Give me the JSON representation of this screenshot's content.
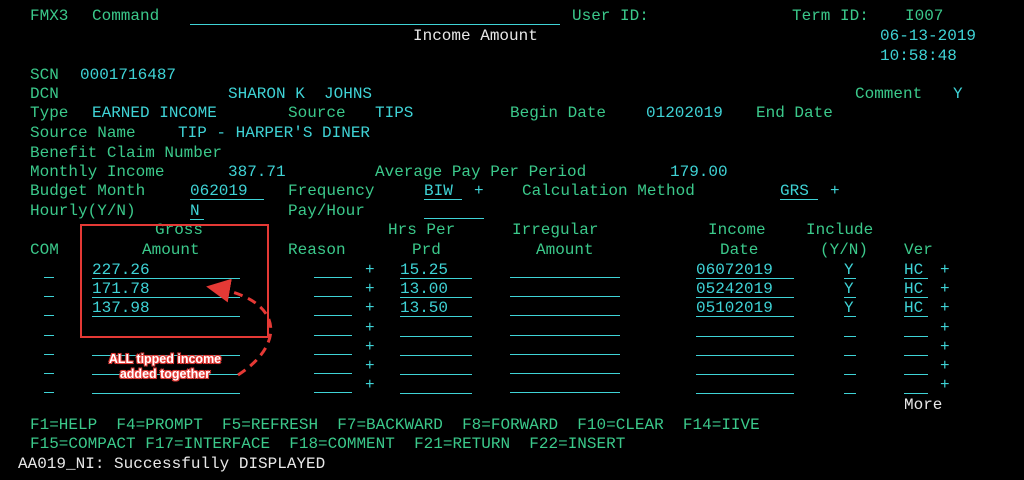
{
  "header": {
    "screen_id": "FMX3",
    "command_label": "Command",
    "user_id_label": "User ID:",
    "term_id_label": "Term ID:",
    "term_id": "I007",
    "title": "Income Amount",
    "date": "06-13-2019",
    "time": "10:58:48"
  },
  "case": {
    "scn_label": "SCN",
    "scn": "0001716487",
    "dcn_label": "DCN",
    "name": "SHARON K  JOHNS",
    "comment_label": "Comment",
    "comment": "Y",
    "type_label": "Type",
    "type": "EARNED INCOME",
    "source_label": "Source",
    "source": "TIPS",
    "begin_date_label": "Begin Date",
    "begin_date": "01202019",
    "end_date_label": "End Date",
    "source_name_label": "Source Name",
    "source_name": "TIP - HARPER'S DINER",
    "benefit_claim_label": "Benefit Claim Number",
    "monthly_income_label": "Monthly Income",
    "monthly_income": "387.71",
    "avg_pay_label": "Average Pay Per Period",
    "avg_pay": "179.00",
    "budget_month_label": "Budget Month",
    "budget_month": "062019",
    "frequency_label": "Frequency",
    "frequency": "BIW",
    "calc_method_label": "Calculation Method",
    "calc_method": "GRS",
    "hourly_label": "Hourly(Y/N)",
    "hourly": "N",
    "pay_hour_label": "Pay/Hour"
  },
  "table": {
    "headers": {
      "com": "COM",
      "gross1": "Gross",
      "gross2": "Amount",
      "reason": "Reason",
      "hrs1": "Hrs Per",
      "hrs2": "Prd",
      "irr1": "Irregular",
      "irr2": "Amount",
      "inc1": "Income",
      "inc2": "Date",
      "incl1": "Include",
      "incl2": "(Y/N)",
      "ver": "Ver"
    },
    "rows": [
      {
        "gross": "227.26",
        "hrs": "15.25",
        "date": "06072019",
        "include": "Y",
        "ver": "HC"
      },
      {
        "gross": "171.78",
        "hrs": "13.00",
        "date": "05242019",
        "include": "Y",
        "ver": "HC"
      },
      {
        "gross": "137.98",
        "hrs": "13.50",
        "date": "05102019",
        "include": "Y",
        "ver": "HC"
      },
      {
        "gross": "",
        "hrs": "",
        "date": "",
        "include": "",
        "ver": ""
      },
      {
        "gross": "",
        "hrs": "",
        "date": "",
        "include": "",
        "ver": ""
      },
      {
        "gross": "",
        "hrs": "",
        "date": "",
        "include": "",
        "ver": ""
      },
      {
        "gross": "",
        "hrs": "",
        "date": "",
        "include": "",
        "ver": ""
      }
    ],
    "plus": "+",
    "more": "More"
  },
  "fkeys": {
    "line1": "F1=HELP  F4=PROMPT  F5=REFRESH  F7=BACKWARD  F8=FORWARD  F10=CLEAR  F14=IIVE",
    "line2": "F15=COMPACT F17=INTERFACE  F18=COMMENT  F21=RETURN  F22=INSERT"
  },
  "status": "AA019_NI: Successfully DISPLAYED",
  "annotation": {
    "line1": "ALL tipped income",
    "line2": "added together",
    "color": "#e53935"
  }
}
